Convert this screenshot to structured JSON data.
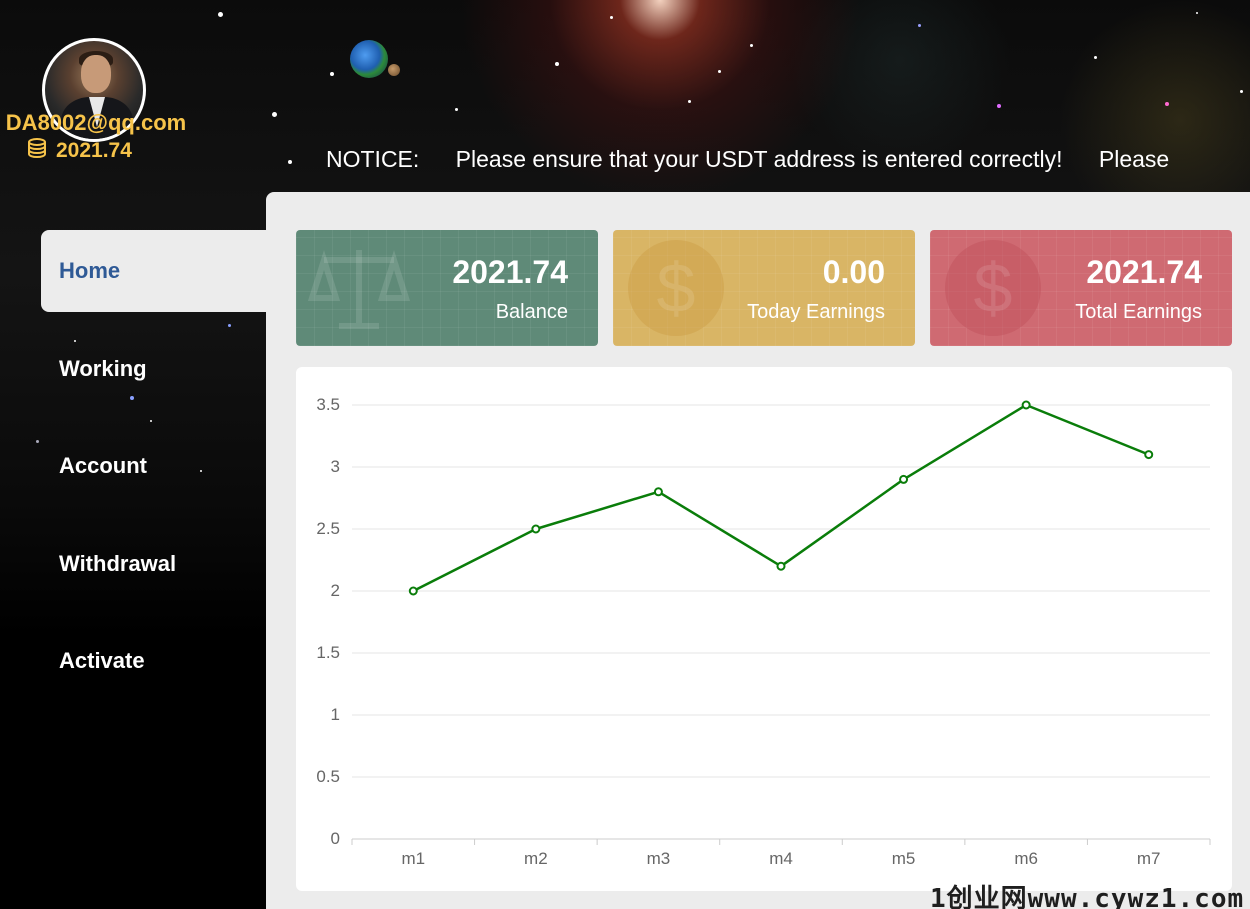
{
  "user": {
    "email": "DA8002@qq.com",
    "balance": "2021.74"
  },
  "notice": {
    "label": "NOTICE:",
    "text": "Please ensure that your USDT address is entered correctly!",
    "text_repeat": "Please"
  },
  "nav": {
    "items": [
      {
        "label": "Home",
        "active": true
      },
      {
        "label": "Working"
      },
      {
        "label": "Account"
      },
      {
        "label": "Withdrawal"
      },
      {
        "label": "Activate"
      }
    ]
  },
  "cards": [
    {
      "value": "2021.74",
      "label": "Balance",
      "color": "#5f8a78",
      "icon": "scale-icon"
    },
    {
      "value": "0.00",
      "label": "Today Earnings",
      "color": "#d9b565",
      "icon": "dollar-icon"
    },
    {
      "value": "2021.74",
      "label": "Total Earnings",
      "color": "#cf6a72",
      "icon": "dollar-icon"
    }
  ],
  "chart_data": {
    "type": "line",
    "categories": [
      "m1",
      "m2",
      "m3",
      "m4",
      "m5",
      "m6",
      "m7"
    ],
    "series": [
      {
        "values": [
          2,
          2.5,
          2.8,
          2.2,
          2.9,
          3.5,
          3.1
        ],
        "color": "#0a7d0a"
      }
    ],
    "ylim": [
      0,
      3.5
    ],
    "yticks": [
      "0",
      "0.5",
      "1",
      "1.5",
      "2",
      "2.5",
      "3",
      "3.5"
    ],
    "grid": true
  },
  "watermark": "1创业网www.cywz1.com"
}
